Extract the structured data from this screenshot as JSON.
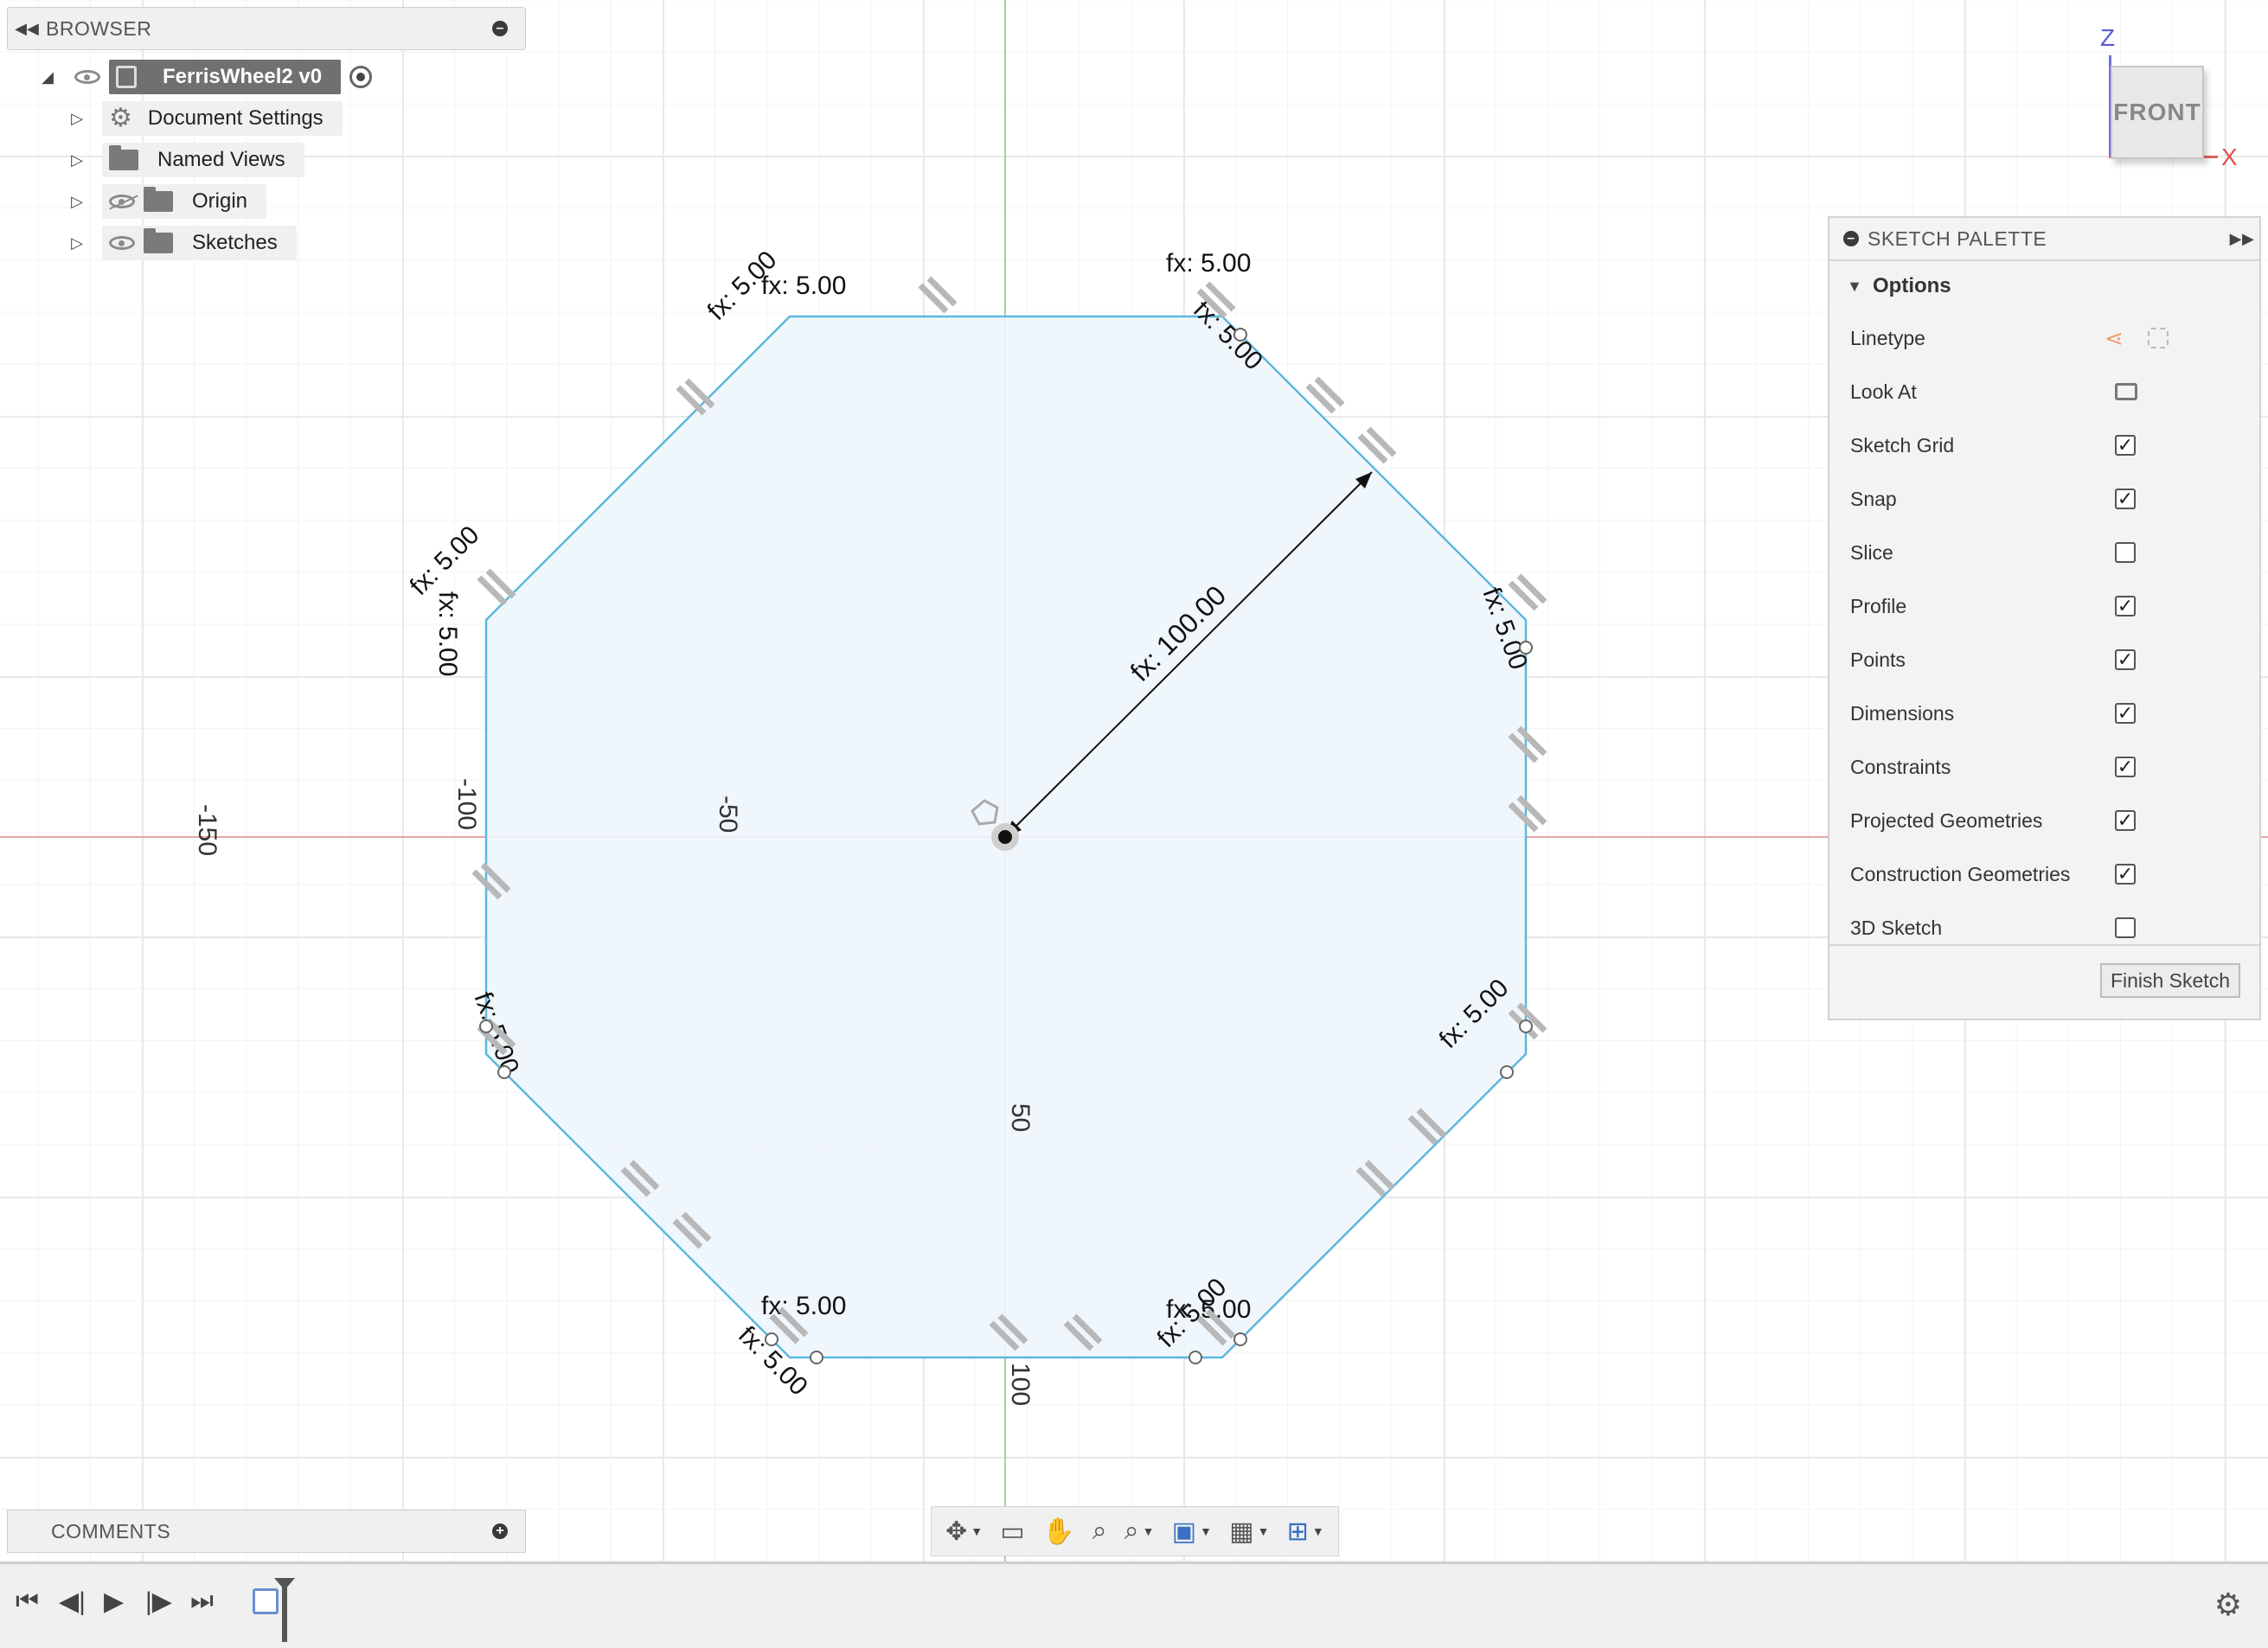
{
  "browser": {
    "title": "BROWSER",
    "root": "FerrisWheel2 v0",
    "items": [
      {
        "label": "Document Settings",
        "icon": "gear-icon"
      },
      {
        "label": "Named Views",
        "icon": "folder-icon"
      },
      {
        "label": "Origin",
        "icon": "folder-icon",
        "visibility": "hidden"
      },
      {
        "label": "Sketches",
        "icon": "folder-icon",
        "visibility": "visible"
      }
    ]
  },
  "viewcube": {
    "face": "FRONT",
    "axis_z": "Z",
    "axis_x": "X"
  },
  "sketch_palette": {
    "title": "SKETCH PALETTE",
    "options_label": "Options",
    "rows": [
      {
        "label": "Linetype",
        "control": "icons"
      },
      {
        "label": "Look At",
        "control": "button"
      },
      {
        "label": "Sketch Grid",
        "checked": true
      },
      {
        "label": "Snap",
        "checked": true
      },
      {
        "label": "Slice",
        "checked": false
      },
      {
        "label": "Profile",
        "checked": true
      },
      {
        "label": "Points",
        "checked": true
      },
      {
        "label": "Dimensions",
        "checked": true
      },
      {
        "label": "Constraints",
        "checked": true
      },
      {
        "label": "Projected Geometries",
        "checked": true
      },
      {
        "label": "Construction Geometries",
        "checked": true
      },
      {
        "label": "3D Sketch",
        "checked": false
      }
    ],
    "finish_button": "Finish Sketch"
  },
  "comments": {
    "title": "COMMENTS"
  },
  "canvas": {
    "grid_labels": [
      "-150",
      "-100",
      "-50",
      "50",
      "100"
    ],
    "radius_dimension": "fx: 100.00",
    "fillet_dimension": "fx: 5.00",
    "colors": {
      "profile_fill": "#eef6fc",
      "profile_edge": "#5bb8de",
      "x_axis": "#e8a4a4",
      "y_axis": "#9ed69e"
    }
  },
  "toolbar": {
    "icons": [
      "orbit-icon",
      "look-at-icon",
      "pan-icon",
      "zoom-icon",
      "zoom-window-icon",
      "display-settings-icon",
      "grid-settings-icon",
      "viewports-icon"
    ]
  },
  "timeline": {
    "buttons": [
      "go-to-start-icon",
      "step-back-icon",
      "play-icon",
      "step-forward-icon",
      "go-to-end-icon"
    ]
  }
}
